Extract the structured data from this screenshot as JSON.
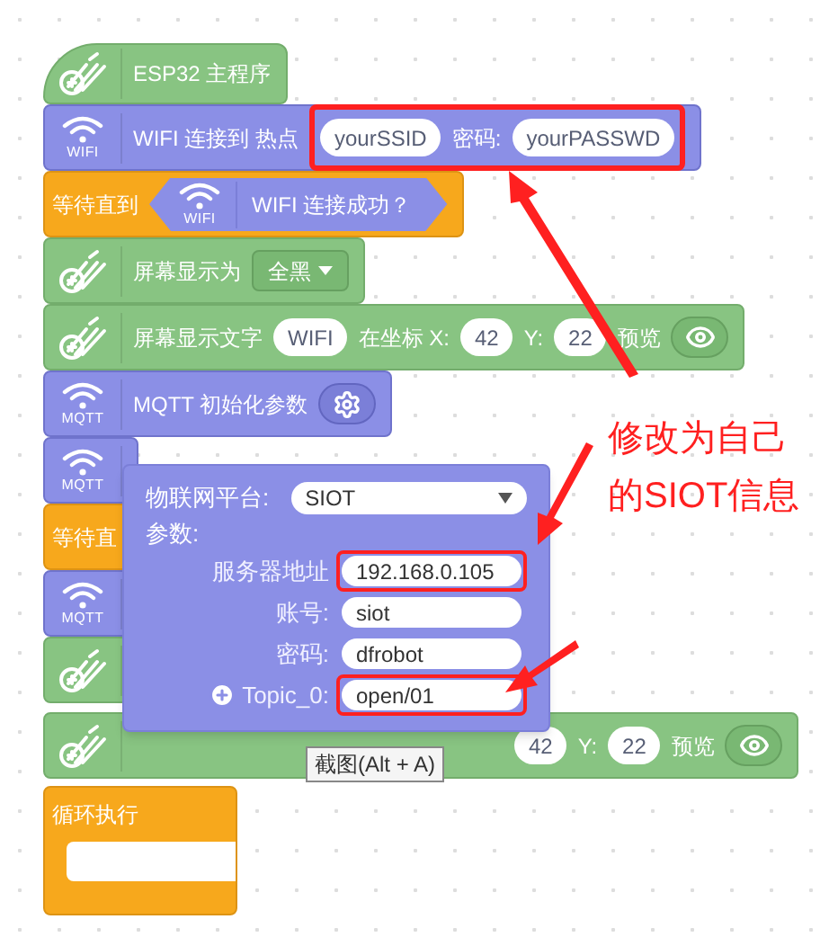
{
  "blocks": [
    {
      "kind": "hat",
      "parts": [
        {
          "kind": "text",
          "text": "ESP32 主程序"
        }
      ]
    },
    {
      "kind": "wifi",
      "icon_label": "WIFI",
      "parts": [
        {
          "kind": "text",
          "text": "WIFI 连接到 热点"
        },
        {
          "kind": "input",
          "text": "yourSSID",
          "highlight": true
        },
        {
          "kind": "text",
          "text": "密码:",
          "highlight": true
        },
        {
          "kind": "input",
          "text": "yourPASSWD",
          "highlight": true
        }
      ]
    },
    {
      "kind": "wait",
      "parts": [
        {
          "kind": "text",
          "text": "等待直到"
        },
        {
          "kind": "condition",
          "icon_label": "WIFI",
          "text": "WIFI 连接成功？"
        }
      ]
    },
    {
      "kind": "display",
      "parts": [
        {
          "kind": "text",
          "text": "屏幕显示为"
        },
        {
          "kind": "dropdown",
          "text": "全黑"
        }
      ]
    },
    {
      "kind": "display",
      "parts": [
        {
          "kind": "text",
          "text": "屏幕显示文字"
        },
        {
          "kind": "input",
          "text": "WIFI"
        },
        {
          "kind": "text",
          "text": "在坐标 X:"
        },
        {
          "kind": "input",
          "text": "42"
        },
        {
          "kind": "text",
          "text": "Y:"
        },
        {
          "kind": "input",
          "text": "22"
        },
        {
          "kind": "text",
          "text": "预览"
        },
        {
          "kind": "eye"
        }
      ]
    },
    {
      "kind": "wifi",
      "icon_label": "MQTT",
      "parts": [
        {
          "kind": "text",
          "text": "MQTT 初始化参数"
        },
        {
          "kind": "gear"
        }
      ]
    },
    {
      "kind": "wifi",
      "icon_label": "MQTT"
    },
    {
      "kind": "wait",
      "parts": [
        {
          "kind": "text",
          "text": "等待直"
        }
      ]
    },
    {
      "kind": "wifi",
      "icon_label": "MQTT"
    },
    {
      "kind": "display"
    },
    {
      "kind": "partial",
      "parts": [
        {
          "kind": "input",
          "text": "42"
        },
        {
          "kind": "text",
          "text": "Y:"
        },
        {
          "kind": "input",
          "text": "22"
        },
        {
          "kind": "text",
          "text": "预览"
        },
        {
          "kind": "eye"
        }
      ]
    },
    {
      "kind": "loop",
      "parts": [
        {
          "kind": "text",
          "text": "循环执行"
        }
      ]
    }
  ],
  "popup": {
    "platform_label": "物联网平台:",
    "platform": "SIOT",
    "params_label": "参数:",
    "fields": [
      {
        "kind": "plain",
        "label": "服务器地址",
        "value": "192.168.0.105",
        "highlight": true
      },
      {
        "kind": "plain",
        "label": "账号:",
        "value": "siot",
        "highlight": false
      },
      {
        "kind": "plain",
        "label": "密码:",
        "value": "dfrobot",
        "highlight": false
      },
      {
        "kind": "add",
        "label": "Topic_0:",
        "value": "open/01",
        "highlight": true
      }
    ]
  },
  "tooltip": {
    "text": "截图(Alt + A)"
  },
  "annotation": {
    "lines": [
      "修改为自己",
      "的SIOT信息"
    ]
  }
}
